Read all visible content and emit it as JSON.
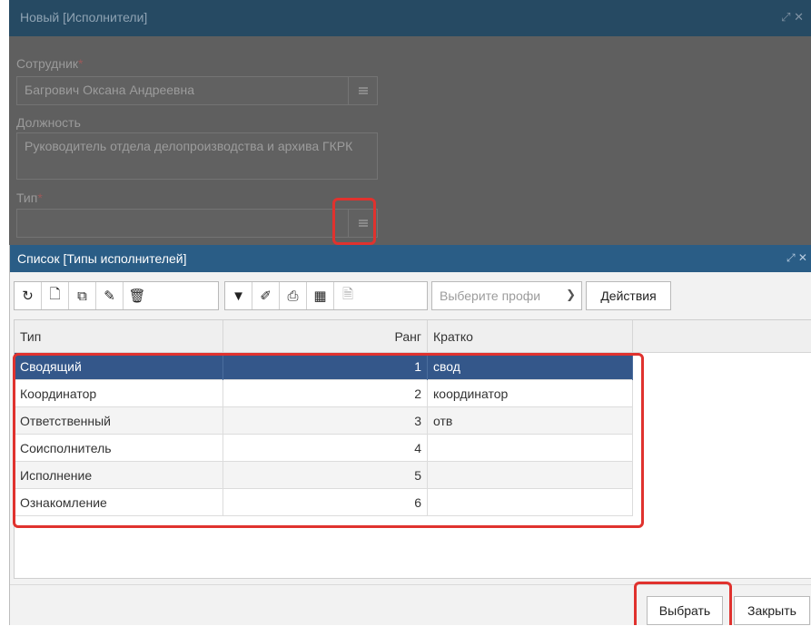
{
  "background_dialog": {
    "title": "Новый [Исполнители]",
    "employee_label": "Сотрудник",
    "employee_value": "Багрович Оксана Андреевна",
    "position_label": "Должность",
    "position_value": "Руководитель отдела делопроизводства и архива ГКРК",
    "type_label": "Тип",
    "type_value": "",
    "required_mark": "*"
  },
  "dialog": {
    "title": "Список [Типы исполнителей]",
    "toolbar": {
      "icons": [
        "refresh-icon",
        "new-document-icon",
        "copy-icon",
        "edit-icon",
        "delete-icon",
        "filter-icon",
        "clear-filter-icon",
        "print-icon",
        "columns-icon",
        "export-icon"
      ],
      "profile_placeholder": "Выберите профи",
      "actions_label": "Действия"
    },
    "columns": [
      "Тип",
      "Ранг",
      "Кратко"
    ],
    "rows": [
      {
        "type": "Сводящий",
        "rank": "1",
        "short": "свод"
      },
      {
        "type": "Координатор",
        "rank": "2",
        "short": "координатор"
      },
      {
        "type": "Ответственный",
        "rank": "3",
        "short": "отв"
      },
      {
        "type": "Соисполнитель",
        "rank": "4",
        "short": ""
      },
      {
        "type": "Исполнение",
        "rank": "5",
        "short": ""
      },
      {
        "type": "Ознакомление",
        "rank": "6",
        "short": ""
      }
    ],
    "selected_row": 0,
    "select_button": "Выбрать",
    "close_button": "Закрыть"
  },
  "colors": {
    "highlight": "#e0322e",
    "selected_row": "#34578a",
    "title_bar": "#2a5d86"
  }
}
